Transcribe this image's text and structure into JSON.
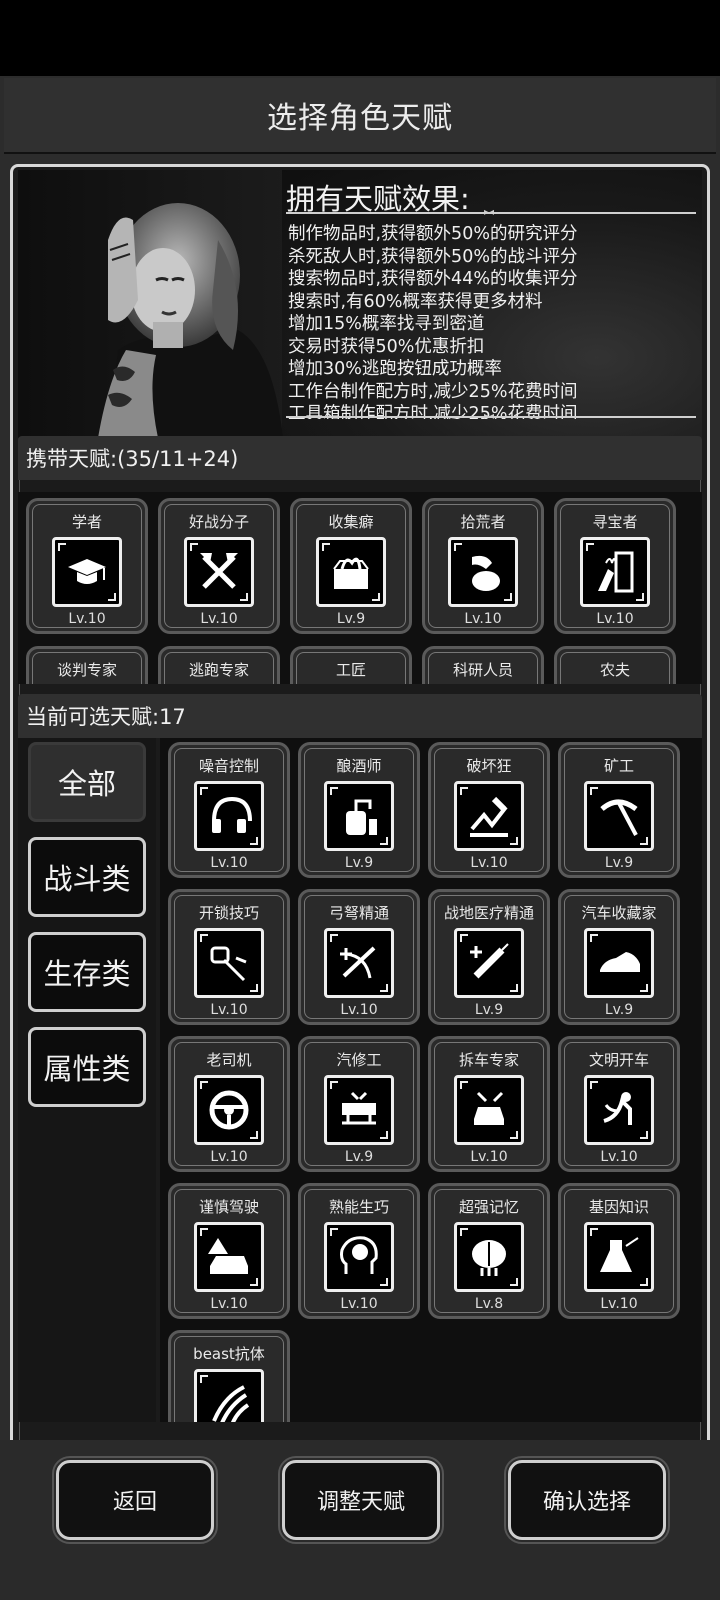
{
  "title": "选择角色天赋",
  "effects": {
    "title": "拥有天赋效果:",
    "lines": [
      "制作物品时,获得额外50%的研究评分",
      "杀死敌人时,获得额外50%的战斗评分",
      "搜索物品时,获得额外44%的收集评分",
      "搜索时,有60%概率获得更多材料",
      "增加15%概率找寻到密道",
      "交易时获得50%优惠折扣",
      "增加30%逃跑按钮成功概率",
      "工作台制作配方时,减少25%花费时间",
      "工具箱制作配方时,减少25%花费时间"
    ]
  },
  "carried": {
    "label": "携带天赋:(35/11+24)",
    "items": [
      {
        "name": "学者",
        "level": "Lv.10",
        "icon": "graduation-cap-icon"
      },
      {
        "name": "好战分子",
        "level": "Lv.10",
        "icon": "crossed-axes-icon"
      },
      {
        "name": "收集癖",
        "level": "Lv.9",
        "icon": "box-icon"
      },
      {
        "name": "拾荒者",
        "level": "Lv.10",
        "icon": "sack-icon"
      },
      {
        "name": "寻宝者",
        "level": "Lv.10",
        "icon": "treasure-door-icon"
      },
      {
        "name": "谈判专家",
        "level": "",
        "icon": ""
      },
      {
        "name": "逃跑专家",
        "level": "",
        "icon": ""
      },
      {
        "name": "工匠",
        "level": "",
        "icon": ""
      },
      {
        "name": "科研人员",
        "level": "",
        "icon": ""
      },
      {
        "name": "农夫",
        "level": "",
        "icon": ""
      }
    ]
  },
  "available": {
    "label": "当前可选天赋:17",
    "items": [
      {
        "name": "噪音控制",
        "level": "Lv.10",
        "icon": "headphones-icon"
      },
      {
        "name": "酿酒师",
        "level": "Lv.9",
        "icon": "still-icon"
      },
      {
        "name": "破坏狂",
        "level": "Lv.10",
        "icon": "smash-icon"
      },
      {
        "name": "矿工",
        "level": "Lv.9",
        "icon": "pickaxe-icon"
      },
      {
        "name": "开锁技巧",
        "level": "Lv.10",
        "icon": "lockpick-icon"
      },
      {
        "name": "弓弩精通",
        "level": "Lv.10",
        "icon": "crossbow-icon"
      },
      {
        "name": "战地医疗精通",
        "level": "Lv.9",
        "icon": "syringe-icon"
      },
      {
        "name": "汽车收藏家",
        "level": "Lv.9",
        "icon": "sports-car-icon"
      },
      {
        "name": "老司机",
        "level": "Lv.10",
        "icon": "steering-wheel-icon"
      },
      {
        "name": "汽修工",
        "level": "Lv.9",
        "icon": "car-lift-icon"
      },
      {
        "name": "拆车专家",
        "level": "Lv.10",
        "icon": "car-dismantle-icon"
      },
      {
        "name": "文明开车",
        "level": "Lv.10",
        "icon": "seated-driver-icon"
      },
      {
        "name": "谨慎驾驶",
        "level": "Lv.10",
        "icon": "warning-car-icon"
      },
      {
        "name": "熟能生巧",
        "level": "Lv.10",
        "icon": "brain-head-icon"
      },
      {
        "name": "超强记忆",
        "level": "Lv.8",
        "icon": "brain-icon"
      },
      {
        "name": "基因知识",
        "level": "Lv.10",
        "icon": "flask-icon"
      },
      {
        "name": "beast抗体",
        "level": "",
        "icon": "claw-marks-icon"
      }
    ]
  },
  "categories": [
    {
      "label": "全部",
      "active": true
    },
    {
      "label": "战斗类",
      "active": false
    },
    {
      "label": "生存类",
      "active": false
    },
    {
      "label": "属性类",
      "active": false
    }
  ],
  "buttons": {
    "back": "返回",
    "adjust": "调整天赋",
    "confirm": "确认选择"
  }
}
